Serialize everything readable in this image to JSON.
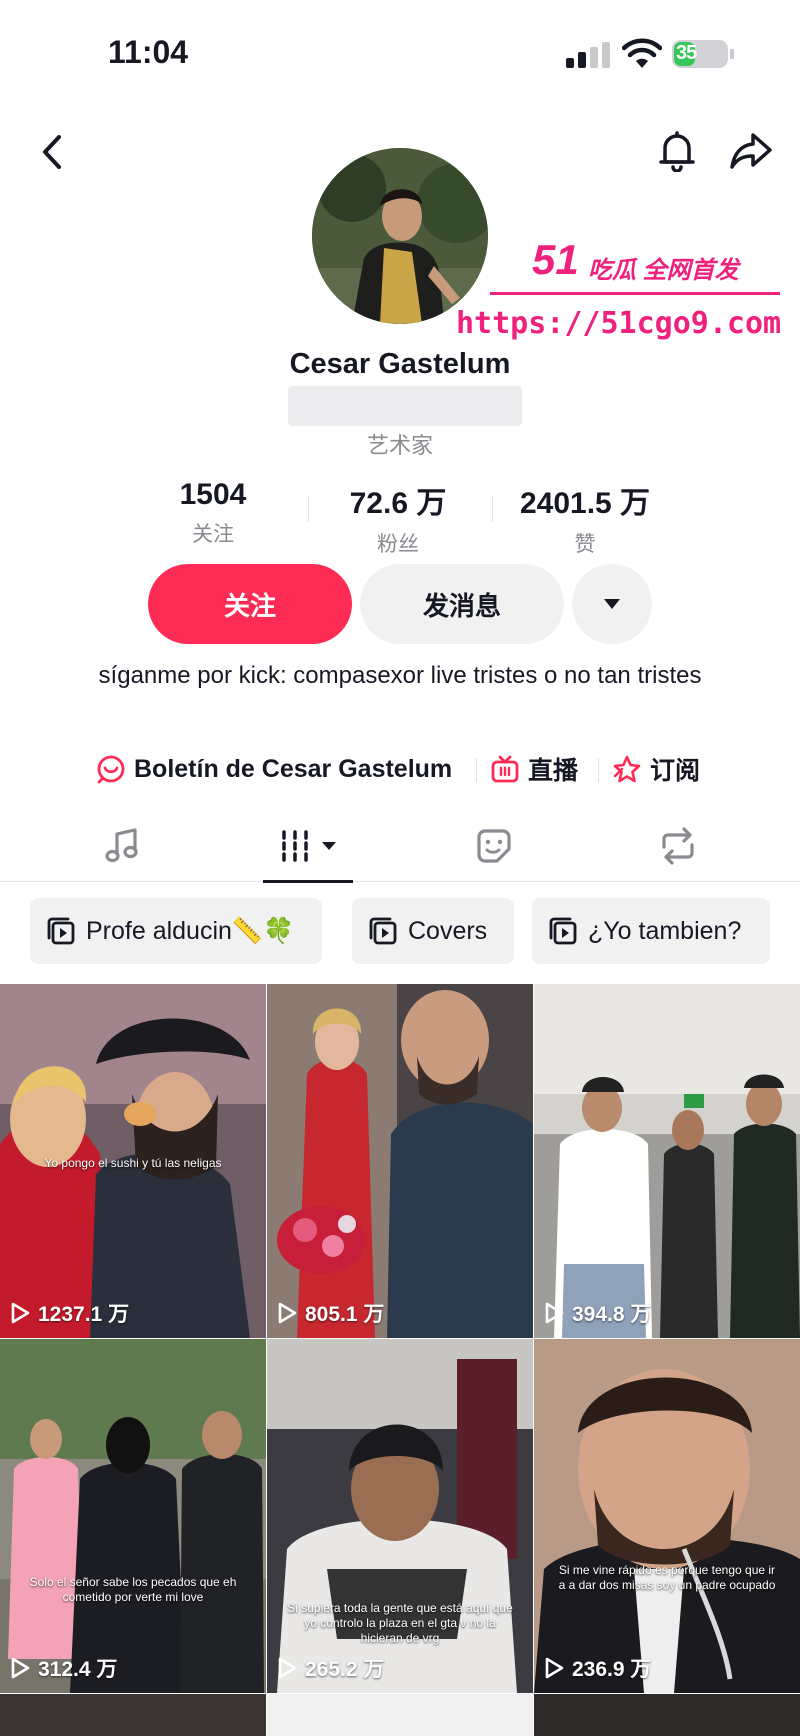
{
  "status_bar": {
    "time": "11:04",
    "battery": "35"
  },
  "profile": {
    "name": "Cesar Gastelum",
    "category": "艺术家",
    "stats": [
      {
        "value": "1504",
        "label": "关注"
      },
      {
        "value": "72.6 万",
        "label": "粉丝"
      },
      {
        "value": "2401.5 万",
        "label": "赞"
      }
    ],
    "follow_label": "关注",
    "message_label": "发消息",
    "bio": "síganme por  kick: compasexor live tristes o no tan tristes",
    "links": {
      "newsletter": "Boletín de Cesar Gastelum",
      "live": "直播",
      "subscribe": "订阅"
    }
  },
  "watermark": {
    "number": "51",
    "text": "吃瓜 全网首发",
    "url": "https://51cgo9.com"
  },
  "playlists": [
    {
      "label": "Profe alducin📏🍀"
    },
    {
      "label": "Covers"
    },
    {
      "label": "¿Yo tambien?"
    }
  ],
  "videos": [
    {
      "views": "1237.1 万",
      "caption": "Yo pongo el sushi y tú las neligas"
    },
    {
      "views": "805.1 万",
      "caption": ""
    },
    {
      "views": "394.8 万",
      "caption": ""
    },
    {
      "views": "312.4 万",
      "caption": "Solo el señor sabe los pecados que eh cometido por verte mi love"
    },
    {
      "views": "265.2 万",
      "caption": "Si supiera toda la gente que está aquí que yo controlo la plaza en el gta v no la hicieran de vrg"
    },
    {
      "views": "236.9 万",
      "caption": "Si me vine rápido es porque tengo que ir a a dar dos misas soy un padre ocupado"
    }
  ],
  "colors": {
    "accent": "#fe2c55",
    "watermark": "#f0217d"
  }
}
